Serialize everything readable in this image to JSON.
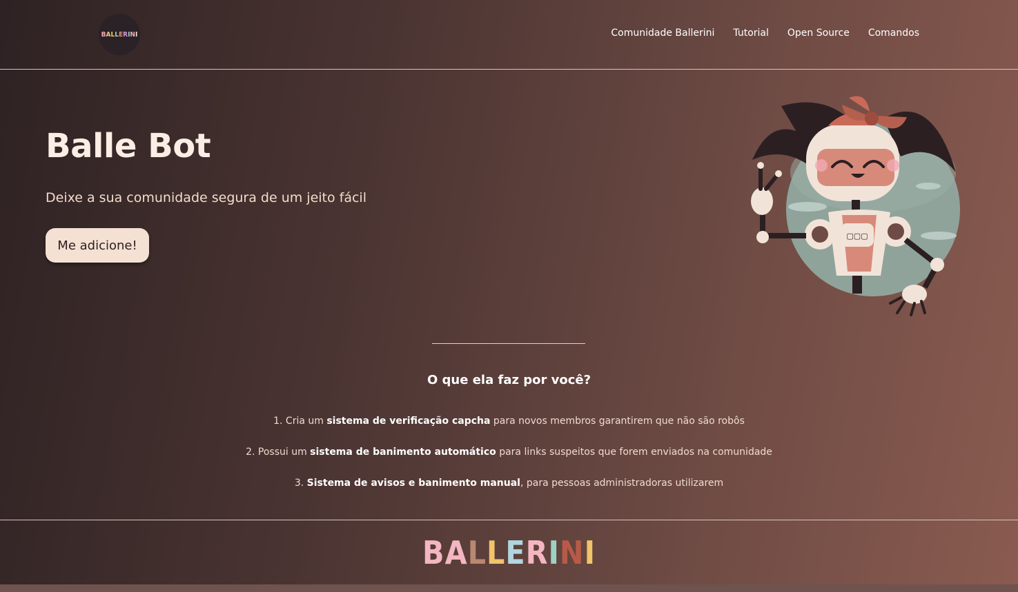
{
  "header": {
    "logo_text": "BALLERINI",
    "nav": [
      "Comunidade Ballerini",
      "Tutorial",
      "Open Source",
      "Comandos"
    ]
  },
  "hero": {
    "title": "Balle Bot",
    "subtitle": "Deixe a sua comunidade segura de um jeito fácil",
    "cta_label": "Me adicione!",
    "screen_glyphs": "▢▢▢"
  },
  "features": {
    "title": "O que ela faz por você?",
    "items": [
      {
        "prefix": "1. Cria um ",
        "bold": "sistema de verificação capcha",
        "suffix": " para novos membros garantirem que não são robôs"
      },
      {
        "prefix": "2. Possui um ",
        "bold": "sistema de banimento automático",
        "suffix": " para links suspeitos que forem enviados na comunidade"
      },
      {
        "prefix": "3. ",
        "bold": "Sistema de avisos e banimento manual",
        "suffix": ", para pessoas administradoras utilizarem"
      }
    ]
  },
  "footer": {
    "brand_letters": [
      "B",
      "A",
      "L",
      "L",
      "E",
      "R",
      "I",
      "N",
      "I"
    ]
  },
  "colors": {
    "background_start": "#2e2223",
    "background_end": "#8a5b50",
    "button_bg": "#f4e1d3",
    "text": "#f3e2d6"
  }
}
